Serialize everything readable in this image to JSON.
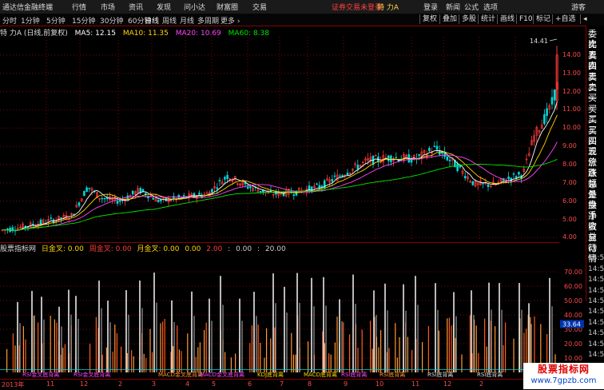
{
  "menubar": {
    "app_name": "通达信金融终端",
    "menus": [
      "行情",
      "市场",
      "资讯",
      "发现",
      "问小达",
      "财富圈",
      "交易"
    ],
    "login_warning": "证券交易未登录",
    "stock_name": "特 力A",
    "right_items": [
      "登录",
      "新闻",
      "公式",
      "选项"
    ],
    "guest": "游客"
  },
  "toolbar": {
    "periods": [
      "分时",
      "1分钟",
      "5分钟",
      "15分钟",
      "30分钟",
      "60分钟",
      "日线",
      "周线",
      "月线",
      "多周期",
      "更多 ›"
    ],
    "active_period": "日线",
    "buttons": [
      "复权",
      "叠加",
      "多股",
      "统计",
      "画线",
      "F10",
      "标记",
      "+自选",
      "◂"
    ]
  },
  "info": {
    "title": "特 力A (日线,前复权)",
    "ma5": "MA5: 12.15",
    "ma10": "MA10: 11.35",
    "ma20": "MA20: 10.69",
    "ma60": "MA60: 8.38",
    "peak_label": "14.41"
  },
  "colors": {
    "up": "#ff3b3b",
    "down": "#00d7d7",
    "ma5": "#ffffff",
    "ma10": "#ffd700",
    "ma20": "#ff44ff",
    "ma60": "#00e600",
    "grid": "#8b0000"
  },
  "y_ticks": [
    "14.00",
    "13.00",
    "12.00",
    "11.00",
    "10.00",
    "9.00",
    "8.00",
    "7.00",
    "6.00",
    "5.00",
    "4.00"
  ],
  "ind_y_ticks": [
    "70.00",
    "60.00",
    "50.00",
    "40.00",
    "30.00",
    "20.00",
    "10.00"
  ],
  "ind_value_marker": "33.64",
  "indicator": {
    "name": "股票指标网",
    "ri": "日金叉: 0.00",
    "zhou": "周金叉: 0.00",
    "yue": "月金叉: 0.00",
    "v1": "0.00",
    "v2": "2.00",
    "v3": "0.00",
    "v4": "20.00"
  },
  "signal_labels": [
    "RSI金叉底背离",
    "RSI金叉底背离",
    "MACD金叉底背离",
    "MACD金叉底背离",
    "KDJ底背离",
    "MACD底背离",
    "RSI底背离",
    "RSI底背离",
    "RSI底背离",
    "RSI底背离"
  ],
  "right_panel": [
    "委比",
    "卖五",
    "卖四",
    "卖三",
    "卖二",
    "卖一",
    "买一",
    "买二",
    "买三",
    "买四",
    "买五",
    "现价",
    "涨跌",
    "涨幅",
    "总量",
    "外盘",
    "换手",
    "净资",
    "收益",
    "自动",
    "行情",
    "14:56",
    "14:56",
    "14:56",
    "14:56",
    "14:56",
    "14:56",
    "14:56",
    "14:56",
    "14:56",
    "14:56"
  ],
  "date_labels": [
    "2013年",
    "11",
    "12",
    "2",
    "3",
    "4",
    "5",
    "6",
    "7",
    "8",
    "9",
    "10",
    "11",
    "12",
    "2"
  ],
  "watermark": {
    "title": "股票指标网",
    "url": "www.7gpzb.com"
  }
}
